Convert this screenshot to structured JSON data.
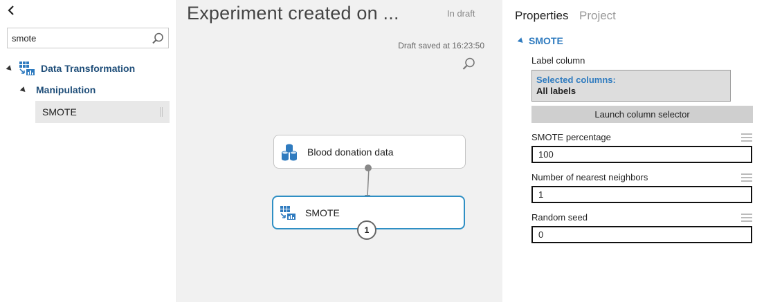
{
  "palette": {
    "search": {
      "value": "smote",
      "placeholder": ""
    },
    "tree": {
      "category": "Data Transformation",
      "subcategory": "Manipulation",
      "module": "SMOTE"
    }
  },
  "canvas": {
    "title": "Experiment created on ...",
    "status": "In draft",
    "saved": "Draft saved at 16:23:50",
    "nodes": [
      {
        "label": "Blood donation data",
        "icon": "dataset-icon"
      },
      {
        "label": "SMOTE",
        "icon": "data-transformation-icon",
        "selected": true,
        "badge": "1"
      }
    ]
  },
  "properties": {
    "tabs": {
      "properties": "Properties",
      "project": "Project"
    },
    "section": "SMOTE",
    "label_column": {
      "label": "Label column",
      "selected_title": "Selected columns:",
      "selected_value": "All labels",
      "button": "Launch column selector"
    },
    "fields": [
      {
        "label": "SMOTE percentage",
        "value": "100"
      },
      {
        "label": "Number of nearest neighbors",
        "value": "1"
      },
      {
        "label": "Random seed",
        "value": "0"
      }
    ]
  },
  "colors": {
    "accent": "#2f7bbf",
    "selected_border": "#2f8fc4",
    "canvas_bg": "#f1f1f1",
    "tree_text": "#1f4e79"
  }
}
